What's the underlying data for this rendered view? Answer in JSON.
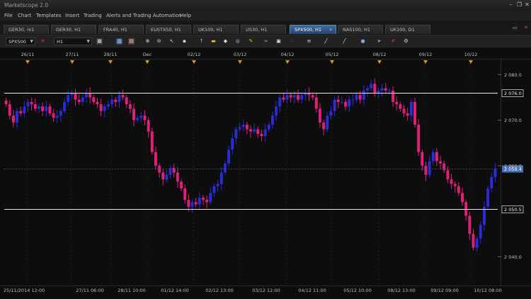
{
  "app": {
    "title": "Marketscope 2.0",
    "minimize": "–",
    "restore": "❐",
    "close": "✕"
  },
  "menu": [
    "File",
    "Chart",
    "Templates",
    "Insert",
    "Trading",
    "Alerts and Trading Automation",
    "Help"
  ],
  "tabs": [
    "GER30, m1",
    "GER30, H1",
    "FRA40, H1",
    "EUSTX50, H1",
    "UK100, H1",
    "US30, H1",
    "SPX500, H1",
    "NAS100, H1",
    "UK100, D1"
  ],
  "active_tab": "SPX500, H1",
  "tab_close": "✕",
  "toolbar": {
    "instrument": "SPX500",
    "timeframe": "H1"
  },
  "top_dates": [
    "26/11",
    "27/11",
    "28/11",
    "Dec",
    "02/12",
    "03/12",
    "04/12",
    "05/12",
    "08/12",
    "09/12",
    "10/12"
  ],
  "bottom_dates": [
    "25/11/2014 12:00",
    "27/11 06:00",
    "28/11 10:00",
    "01/12 14:00",
    "02/12 13:00",
    "03/12 12:00",
    "04/12 11:00",
    "05/12 10:00",
    "08/12 13:00",
    "09/12 09:00",
    "10/12 08:00"
  ],
  "price_ticks": [
    "2 080.0",
    "2 070.0",
    "2 060.0",
    "2 040.0"
  ],
  "levels": [
    {
      "value": 2076.0,
      "label": "2 076.0"
    },
    {
      "value": 2050.5,
      "label": "2 050.5"
    }
  ],
  "current": {
    "value": 2059.4,
    "label": "2 059.4"
  },
  "colors": {
    "up": "#2b2bd8",
    "down": "#e0207a",
    "marker": "#d89a1a",
    "level": "#e8e8e8",
    "current": "#4a70b8"
  },
  "chart_data": {
    "type": "candlestick",
    "ylim": [
      2034,
      2083
    ],
    "series_close": [
      2073.5,
      2071,
      2069.5,
      2072,
      2071.5,
      2073,
      2074,
      2073.5,
      2072.5,
      2073,
      2072,
      2073,
      2071.5,
      2070.5,
      2071,
      2072,
      2074,
      2075.5,
      2076,
      2074.5,
      2074,
      2075,
      2076,
      2075,
      2074,
      2073.5,
      2072,
      2073,
      2073.5,
      2074.5,
      2074,
      2075.5,
      2075,
      2073.5,
      2072.5,
      2070,
      2070.5,
      2071,
      2070,
      2067.5,
      2063,
      2060,
      2058.5,
      2057,
      2058,
      2059.5,
      2058.5,
      2056.5,
      2055,
      2052.5,
      2051,
      2052,
      2051.5,
      2053,
      2052.5,
      2052,
      2054,
      2055.5,
      2056,
      2058.5,
      2060.5,
      2063.5,
      2066,
      2068,
      2068.5,
      2069,
      2068,
      2067.5,
      2068,
      2067,
      2066.5,
      2068,
      2069,
      2071,
      2073,
      2075,
      2074.5,
      2075.5,
      2075,
      2075.5,
      2074.5,
      2075.5,
      2076,
      2075.5,
      2075,
      2072.5,
      2069.5,
      2068,
      2071,
      2072,
      2074.5,
      2074,
      2074,
      2073,
      2074.5,
      2074.5,
      2075.5,
      2074.5,
      2076.5,
      2077,
      2078,
      2076,
      2076.5,
      2077,
      2076.5,
      2076.5,
      2074,
      2073.5,
      2072.5,
      2071.5,
      2071,
      2074,
      2069,
      2063,
      2060,
      2058,
      2061,
      2063,
      2061,
      2060.5,
      2059,
      2057,
      2056,
      2055.5,
      2054,
      2052,
      2049,
      2045,
      2042,
      2044,
      2047,
      2051,
      2055,
      2057.5,
      2059.4
    ]
  }
}
